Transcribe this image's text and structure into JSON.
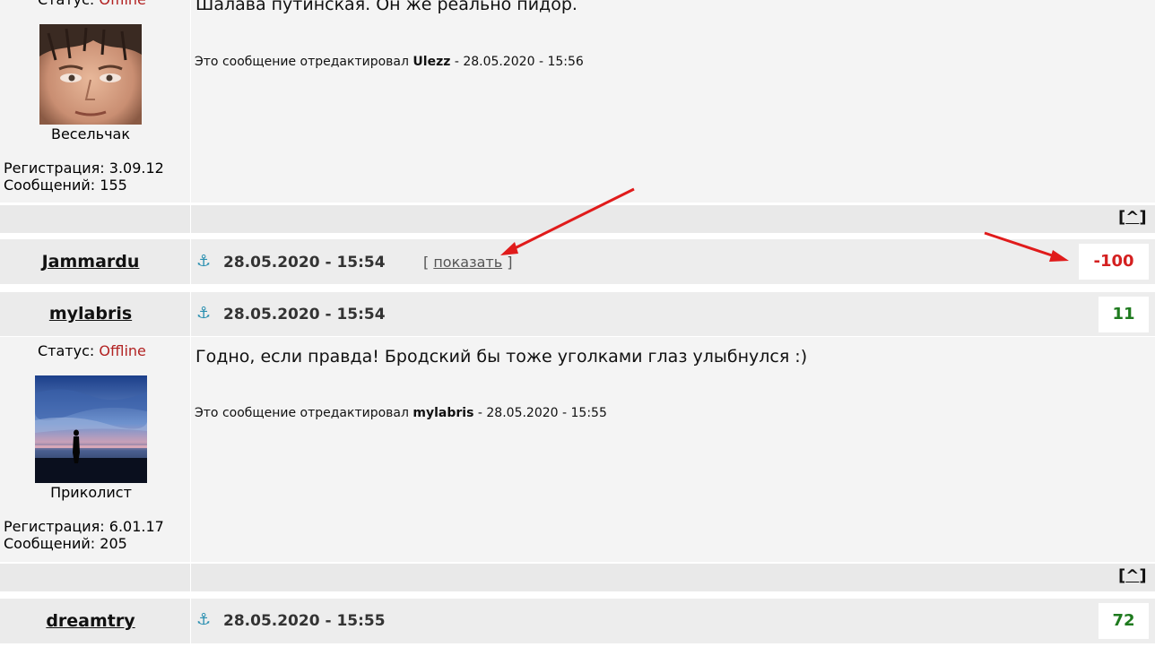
{
  "top_post": {
    "status_label": "Статус:",
    "status_value": "Offline",
    "rank": "Весельчак",
    "reg_label": "Регистрация:",
    "reg_value": "3.09.12",
    "msgs_label": "Сообщений:",
    "msgs_value": "155",
    "text": "Шалава путинская. Он же реально пидор.",
    "edit_prefix": "Это сообщение отредактировал",
    "edit_user": "Ulezz",
    "edit_date": "- 28.05.2020 - 15:56",
    "up_link": "^"
  },
  "post_jammardu": {
    "username": "Jammardu",
    "datetime": "28.05.2020 - 15:54",
    "show_open": "[",
    "show_label": "показать",
    "show_close": "]",
    "rating": "-100"
  },
  "post_mylabris": {
    "username": "mylabris",
    "datetime": "28.05.2020 - 15:54",
    "rating": "11",
    "status_label": "Статус:",
    "status_value": "Offline",
    "rank": "Приколист",
    "reg_label": "Регистрация:",
    "reg_value": "6.01.17",
    "msgs_label": "Сообщений:",
    "msgs_value": "205",
    "text": "Годно, если правда! Бродский бы тоже уголками глаз улыбнулся :)",
    "edit_prefix": "Это сообщение отредактировал",
    "edit_user": "mylabris",
    "edit_date": "- 28.05.2020 - 15:55",
    "up_link": "^"
  },
  "post_dreamtry": {
    "username": "dreamtry",
    "datetime": "28.05.2020 - 15:55",
    "rating": "72"
  },
  "icons": {
    "anchor": "⚓"
  },
  "colors": {
    "offline": "#b22222",
    "negative": "#d42020",
    "positive": "#1e7a1e",
    "annotation_arrow": "#e01b1b"
  }
}
